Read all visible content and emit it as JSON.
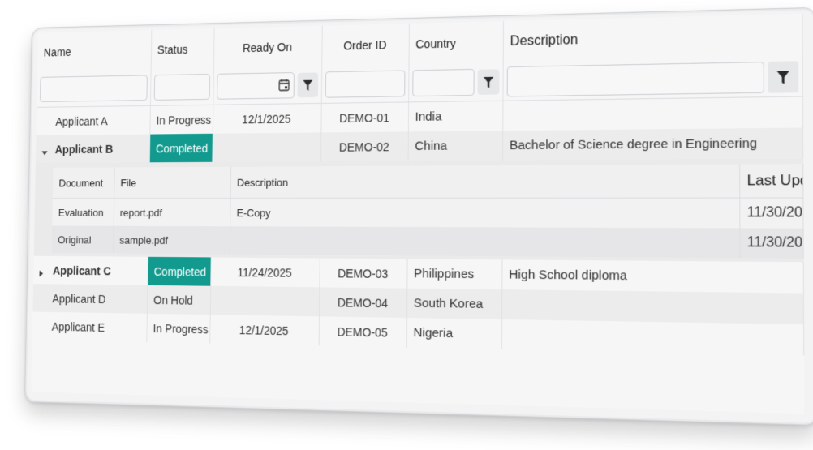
{
  "columns": {
    "name": "Name",
    "status": "Status",
    "ready_on": "Ready On",
    "order_id": "Order ID",
    "country": "Country",
    "description": "Description"
  },
  "rows": [
    {
      "name": "Applicant A",
      "status": "In Progress",
      "ready_on": "12/1/2025",
      "order_id": "DEMO-01",
      "country": "India",
      "description": ""
    },
    {
      "name": "Applicant B",
      "status": "Completed",
      "ready_on": "",
      "order_id": "DEMO-02",
      "country": "China",
      "description": "Bachelor of Science degree in Engineering"
    },
    {
      "name": "Applicant C",
      "status": "Completed",
      "ready_on": "11/24/2025",
      "order_id": "DEMO-03",
      "country": "Philippines",
      "description": "High School diploma"
    },
    {
      "name": "Applicant D",
      "status": "On Hold",
      "ready_on": "",
      "order_id": "DEMO-04",
      "country": "South Korea",
      "description": ""
    },
    {
      "name": "Applicant E",
      "status": "In Progress",
      "ready_on": "12/1/2025",
      "order_id": "DEMO-05",
      "country": "Nigeria",
      "description": ""
    }
  ],
  "detail": {
    "columns": {
      "document": "Document",
      "file": "File",
      "description": "Description",
      "last_updated": "Last Upd"
    },
    "rows": [
      {
        "document": "Evaluation",
        "file": "report.pdf",
        "description": "E-Copy",
        "last_updated": "11/30/20"
      },
      {
        "document": "Original",
        "file": "sample.pdf",
        "description": "",
        "last_updated": "11/30/20"
      }
    ]
  },
  "icons": {
    "filter": "funnel-icon",
    "calendar": "calendar-icon",
    "expanded": "triangle-down-icon",
    "collapsed": "triangle-right-icon"
  },
  "colors": {
    "completed_badge": "#139a8f",
    "card_background": "#f3f3f4",
    "alt_row": "#ececed"
  }
}
